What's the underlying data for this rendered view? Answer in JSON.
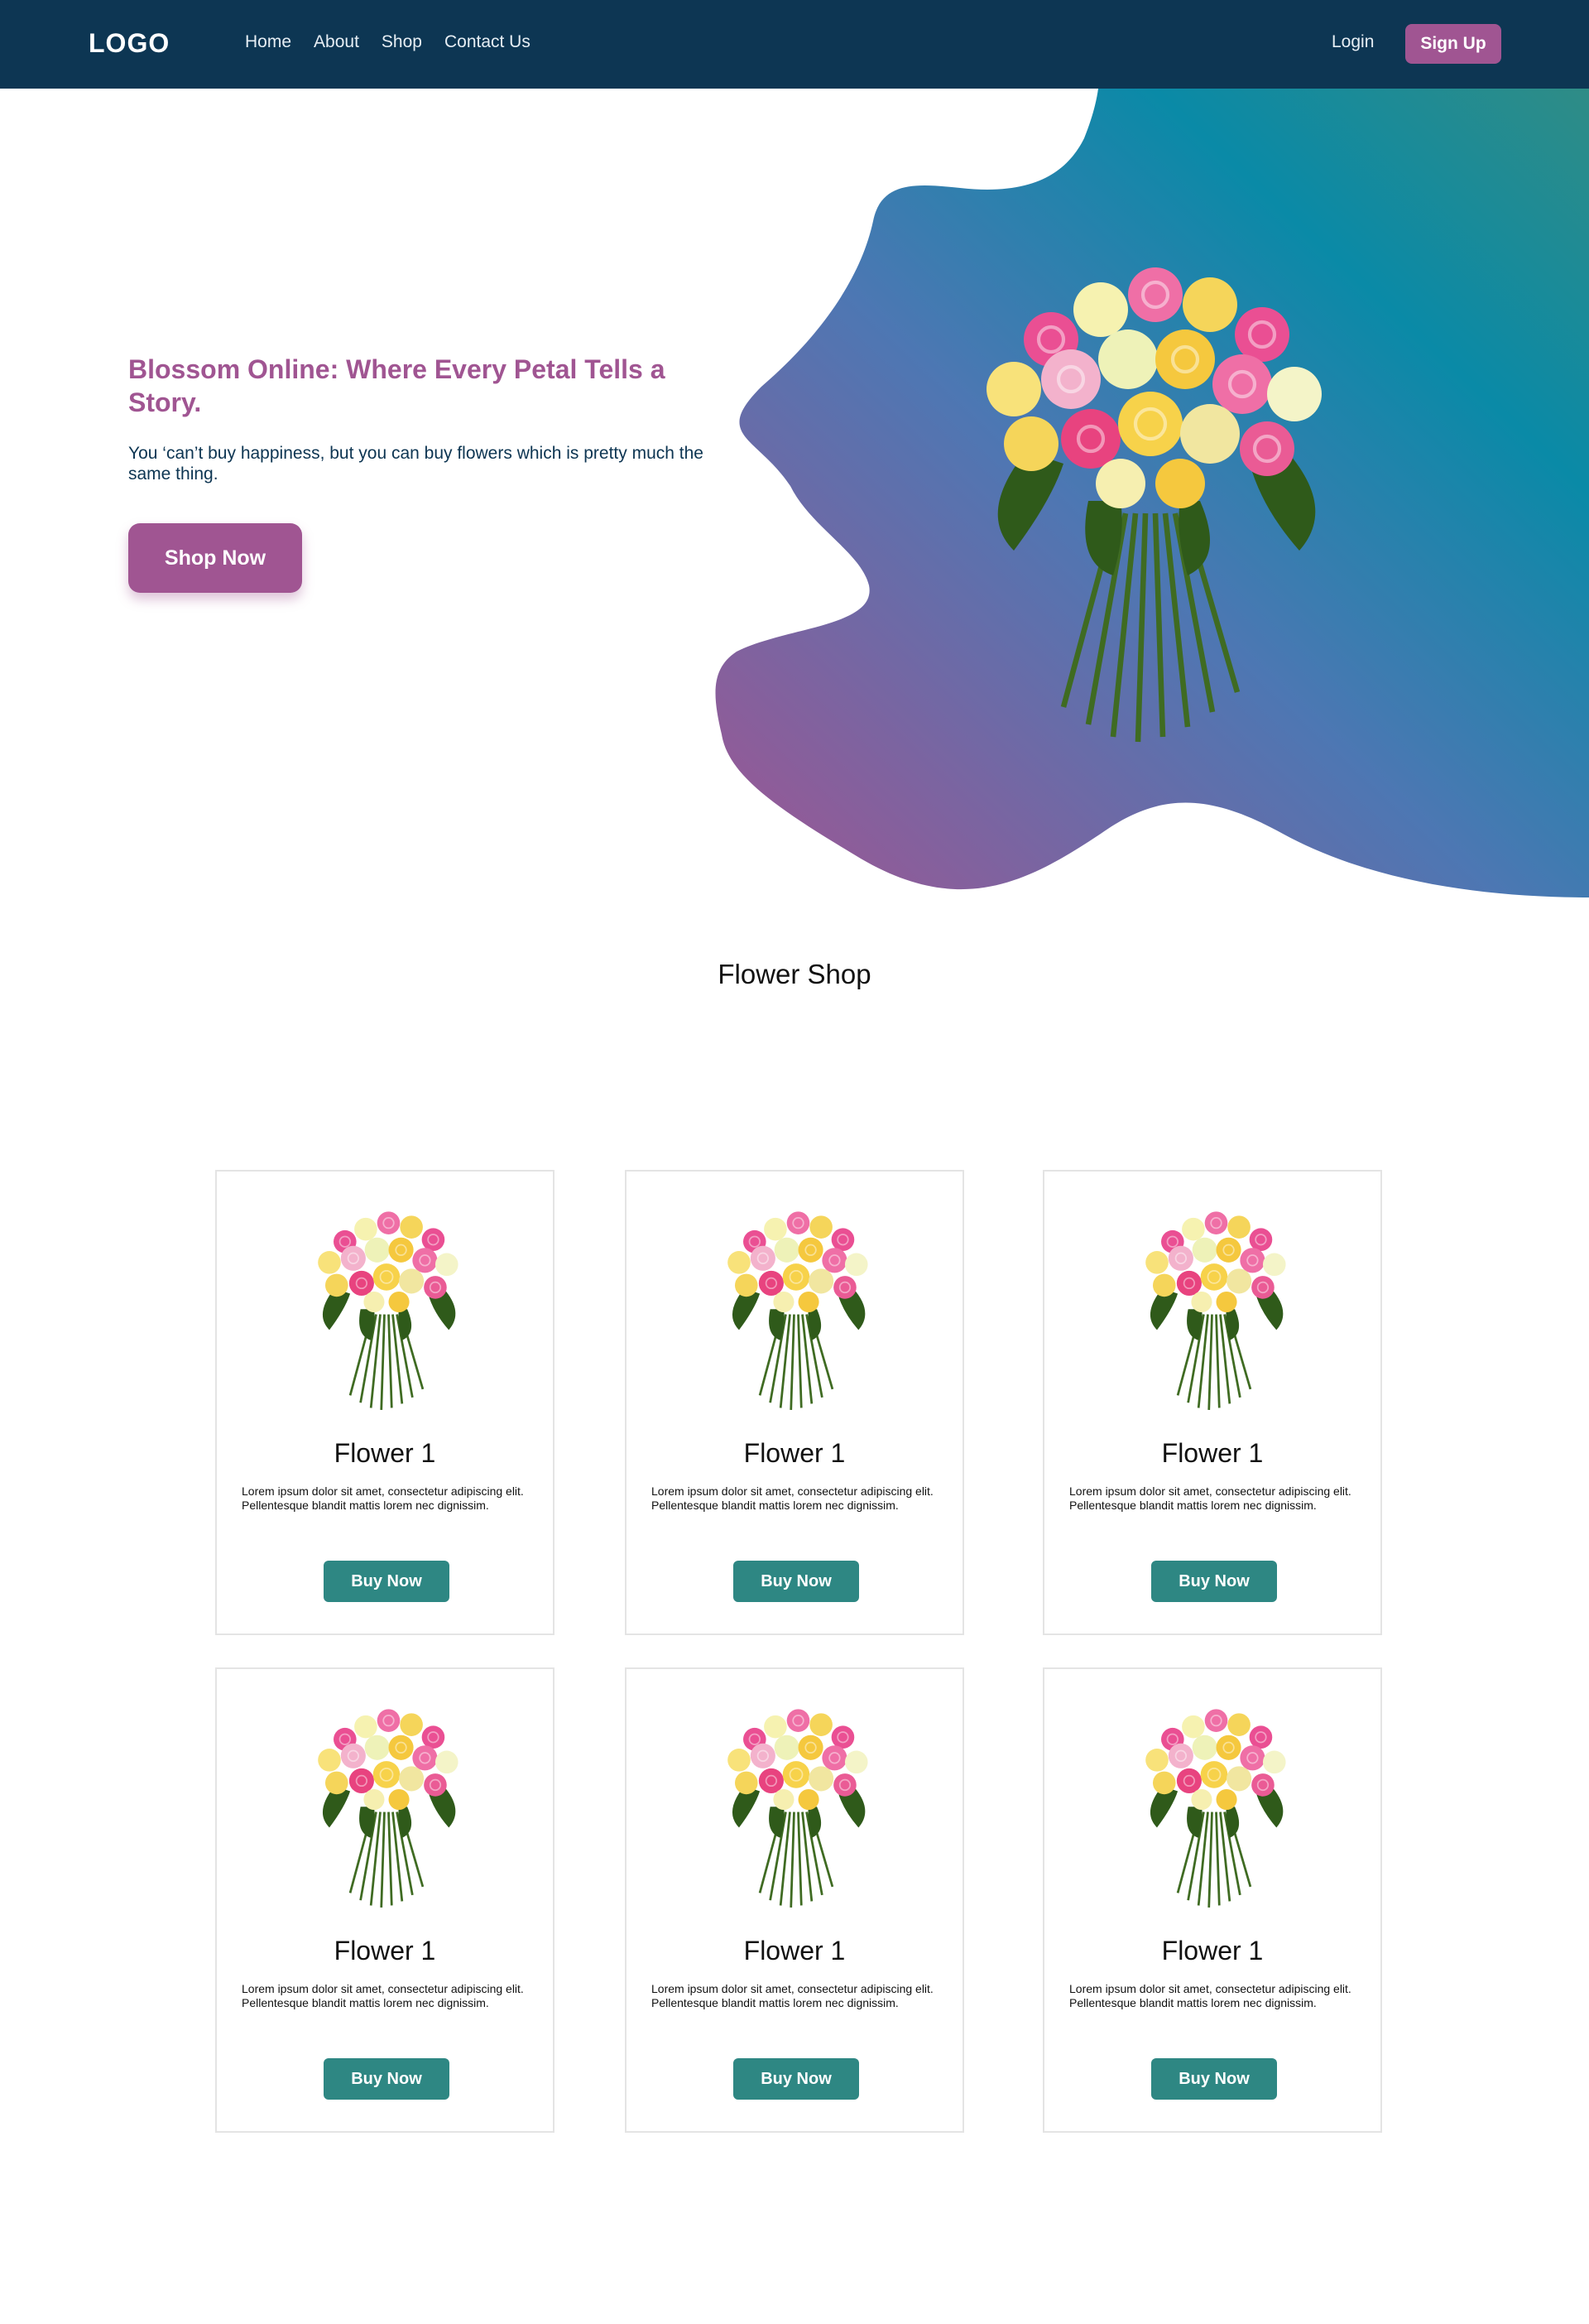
{
  "navbar": {
    "logo": "LOGO",
    "links": [
      "Home",
      "About",
      "Shop",
      "Contact Us"
    ],
    "login": "Login",
    "signup": "Sign Up"
  },
  "hero": {
    "title": "Blossom Online: Where Every Petal Tells a Story.",
    "subtitle": "You ‘can’t buy happiness, but you can buy flowers which is pretty much the same thing.",
    "cta": "Shop Now"
  },
  "colors": {
    "navbar": "#0d3653",
    "accent": "#a05592",
    "buy_button": "#2e8783",
    "gradient": [
      "#a05592",
      "#4a78b4",
      "#0a8aa7"
    ]
  },
  "shop": {
    "title": "Flower Shop",
    "cards": [
      {
        "name": "Flower 1",
        "description": "Lorem ipsum dolor sit amet, consectetur adipiscing elit. Pellentesque blandit mattis lorem nec dignissim.",
        "button": "Buy Now"
      },
      {
        "name": "Flower 1",
        "description": "Lorem ipsum dolor sit amet, consectetur adipiscing elit. Pellentesque blandit mattis lorem nec dignissim.",
        "button": "Buy Now"
      },
      {
        "name": "Flower 1",
        "description": "Lorem ipsum dolor sit amet, consectetur adipiscing elit. Pellentesque blandit mattis lorem nec dignissim.",
        "button": "Buy Now"
      },
      {
        "name": "Flower 1",
        "description": "Lorem ipsum dolor sit amet, consectetur adipiscing elit. Pellentesque blandit mattis lorem nec dignissim.",
        "button": "Buy Now"
      },
      {
        "name": "Flower 1",
        "description": "Lorem ipsum dolor sit amet, consectetur adipiscing elit. Pellentesque blandit mattis lorem nec dignissim.",
        "button": "Buy Now"
      },
      {
        "name": "Flower 1",
        "description": "Lorem ipsum dolor sit amet, consectetur adipiscing elit. Pellentesque blandit mattis lorem nec dignissim.",
        "button": "Buy Now"
      }
    ]
  }
}
